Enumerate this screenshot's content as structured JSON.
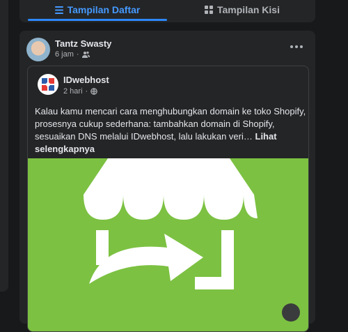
{
  "tabs": [
    {
      "label": "Tampilan Daftar",
      "icon": "list-icon",
      "active": true
    },
    {
      "label": "Tampilan Kisi",
      "icon": "grid-icon",
      "active": false
    }
  ],
  "post": {
    "author": "Tantz Swasty",
    "time": "6 jam",
    "audience_icon": "friends-icon",
    "more_icon": "more-horizontal-icon",
    "shared": {
      "page_name": "IDwebhost",
      "time": "2 hari",
      "audience_icon": "globe-icon",
      "text": "Kalau kamu mencari cara menghubungkan domain ke toko Shopify, prosesnya cukup sederhana: tambahkan domain di Shopify, sesuaikan DNS melalui IDwebhost, lalu lakukan veri…",
      "see_more": "Lihat selengkapnya",
      "image_icon": "shop-redirect-icon"
    }
  },
  "colors": {
    "background": "#18191a",
    "card": "#242526",
    "accent": "#2d88ff",
    "image_bg": "#7cc142"
  }
}
